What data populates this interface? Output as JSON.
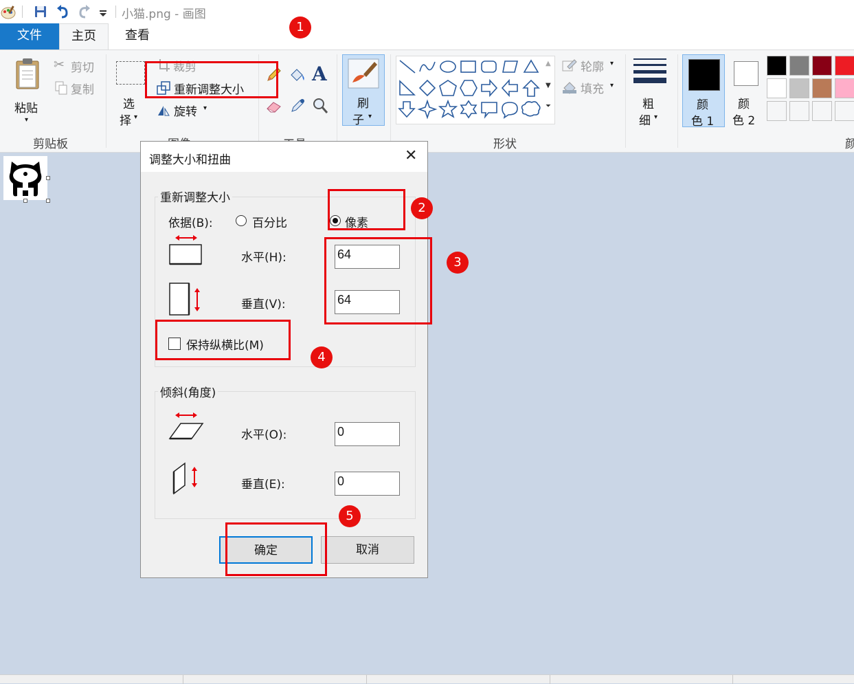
{
  "window": {
    "title": "小猫.png - 画图"
  },
  "tabs": {
    "file": "文件",
    "home": "主页",
    "view": "查看"
  },
  "clipboard": {
    "paste": "粘贴",
    "cut": "剪切",
    "copy": "复制",
    "label": "剪贴板"
  },
  "image": {
    "select_line1": "选",
    "select_line2": "择",
    "crop": "裁剪",
    "resize": "重新调整大小",
    "rotate": "旋转",
    "label": "图像"
  },
  "tools": {
    "label": "工具"
  },
  "brush": {
    "line1": "刷",
    "line2": "子"
  },
  "shapes": {
    "outline": "轮廓",
    "fill": "填充",
    "label": "形状"
  },
  "size": {
    "line1": "粗",
    "line2": "细"
  },
  "colors": {
    "color1_line1": "颜",
    "color1_line2": "色 1",
    "color2_line1": "颜",
    "color2_line2": "色 2",
    "label_partial": "颜",
    "palette_row1": [
      "#000000",
      "#7f7f7f",
      "#880015",
      "#ed1c24"
    ],
    "palette_row2": [
      "#ffffff",
      "#c3c3c3",
      "#b97a57",
      "#ffaec9"
    ]
  },
  "dialog": {
    "title": "调整大小和扭曲",
    "resize_legend": "重新调整大小",
    "by_label": "依据(B):",
    "percent": "百分比",
    "pixels": "像素",
    "horizontal_label": "水平(H):",
    "horizontal_value": "64",
    "vertical_label": "垂直(V):",
    "vertical_value": "64",
    "keep_ratio": "保持纵横比(M)",
    "skew_legend": "倾斜(角度)",
    "skew_h_label": "水平(O):",
    "skew_h_value": "0",
    "skew_v_label": "垂直(E):",
    "skew_v_value": "0",
    "ok": "确定",
    "cancel": "取消"
  },
  "annotations": [
    "1",
    "2",
    "3",
    "4",
    "5"
  ],
  "accent": "#1979ca",
  "highlight": "#e8000b"
}
